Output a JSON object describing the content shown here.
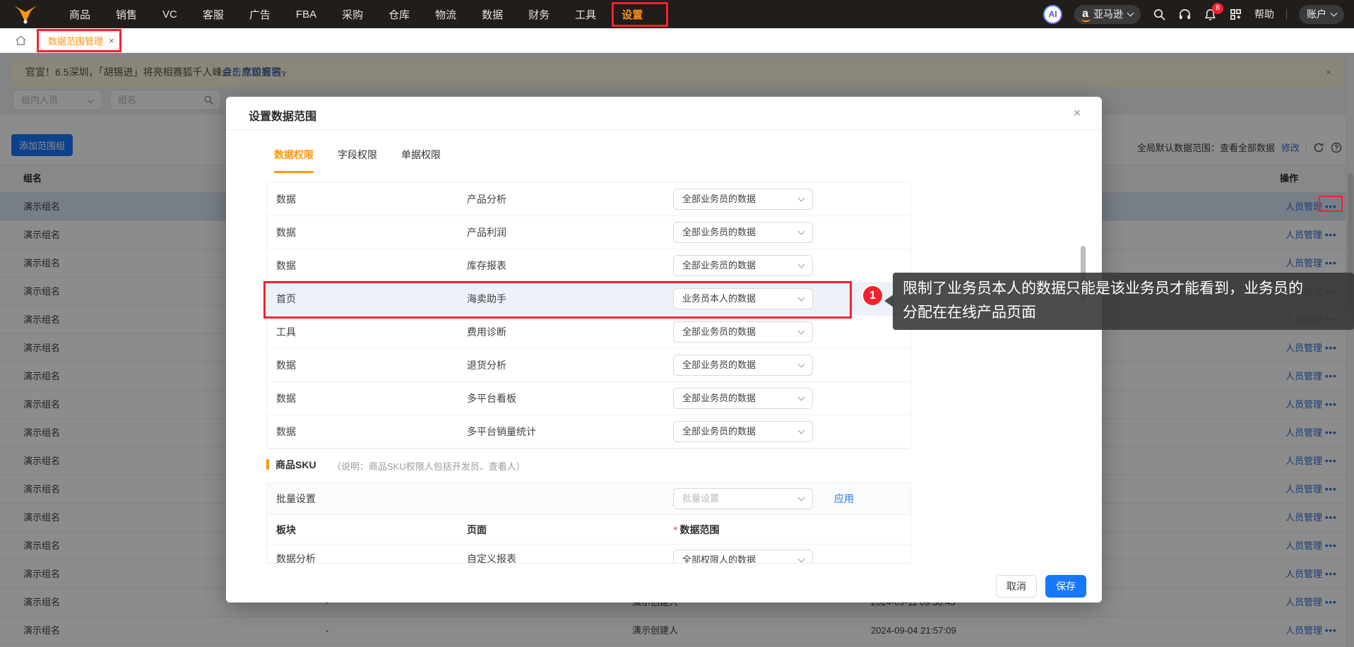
{
  "navbar": {
    "logo": "fox-logo",
    "items": [
      {
        "label": "商品"
      },
      {
        "label": "销售"
      },
      {
        "label": "VC"
      },
      {
        "label": "客服"
      },
      {
        "label": "广告"
      },
      {
        "label": "FBA"
      },
      {
        "label": "采购"
      },
      {
        "label": "仓库"
      },
      {
        "label": "物流"
      },
      {
        "label": "数据"
      },
      {
        "label": "财务"
      },
      {
        "label": "工具"
      },
      {
        "label": "设置",
        "active": true
      }
    ],
    "right": {
      "ai": "AI",
      "marketplace": "亚马逊",
      "amazon_a": "a",
      "bell_badge": "8",
      "help": "帮助",
      "account": "账户"
    }
  },
  "tabbar": {
    "tab": {
      "label": "数据范围管理",
      "close": "×"
    }
  },
  "banner": {
    "text": "官宣！6.5深圳，「胡锡进」将亮相赛狐千人峰会！席位有限，",
    "link": "点击立即报名~",
    "close": "×"
  },
  "filters": {
    "member_placeholder": "组内人员",
    "group_placeholder": "组名"
  },
  "toolbar": {
    "add_button": "添加范围组",
    "global_scope_label": "全局默认数据范围：查看全部数据",
    "modify_link": "修改"
  },
  "bg_table": {
    "headers": {
      "name": "组名",
      "action": "操作"
    },
    "action_label": "人员管理",
    "more_label": "•••",
    "rows": [
      {
        "name": "演示组名",
        "selected": true,
        "annotated": true
      },
      {
        "name": "演示组名"
      },
      {
        "name": "演示组名"
      },
      {
        "name": "演示组名"
      },
      {
        "name": "演示组名"
      },
      {
        "name": "演示组名"
      },
      {
        "name": "演示组名"
      },
      {
        "name": "演示组名"
      },
      {
        "name": "演示组名"
      },
      {
        "name": "演示组名"
      },
      {
        "name": "演示组名"
      },
      {
        "name": "演示组名"
      },
      {
        "name": "演示组名"
      },
      {
        "name": "演示组名"
      },
      {
        "name": "演示组名",
        "dash": "-",
        "creator": "演示创建人",
        "time": "2024-09-11 09:30:43"
      },
      {
        "name": "演示组名",
        "dash": "-",
        "creator": "演示创建人",
        "time": "2024-09-04 21:57:09"
      }
    ]
  },
  "modal": {
    "title": "设置数据范围",
    "close": "×",
    "tabs": [
      {
        "label": "数据权限",
        "active": true
      },
      {
        "label": "字段权限"
      },
      {
        "label": "单据权限"
      }
    ],
    "perm_table": {
      "rows": [
        {
          "module": "数据",
          "page": "产品分析",
          "scope": "全部业务员的数据"
        },
        {
          "module": "数据",
          "page": "产品利润",
          "scope": "全部业务员的数据"
        },
        {
          "module": "数据",
          "page": "库存报表",
          "scope": "全部业务员的数据"
        },
        {
          "module": "首页",
          "page": "海卖助手",
          "scope": "业务员本人的数据",
          "highlighted": true
        },
        {
          "module": "工具",
          "page": "费用诊断",
          "scope": "全部业务员的数据"
        },
        {
          "module": "数据",
          "page": "退货分析",
          "scope": "全部业务员的数据"
        },
        {
          "module": "数据",
          "page": "多平台看板",
          "scope": "全部业务员的数据"
        },
        {
          "module": "数据",
          "page": "多平台销量统计",
          "scope": "全部业务员的数据"
        }
      ]
    },
    "sku_section": {
      "title": "商品SKU",
      "note": "（说明：商品SKU权限人包括开发员、查看人）",
      "batch_label": "批量设置",
      "batch_placeholder": "批量设置",
      "apply_link": "应用",
      "headers": {
        "module": "板块",
        "page": "页面",
        "scope": "数据范围",
        "required_mark": "*"
      },
      "partial_row": {
        "module": "数据分析",
        "page": "自定义报表",
        "scope": "全部权限人的数据"
      }
    },
    "footer": {
      "cancel": "取消",
      "save": "保存"
    }
  },
  "annotation": {
    "badge": "1",
    "tooltip": "限制了业务员本人的数据只能是该业务员才能看到，业务员的分配在在线产品页面"
  }
}
